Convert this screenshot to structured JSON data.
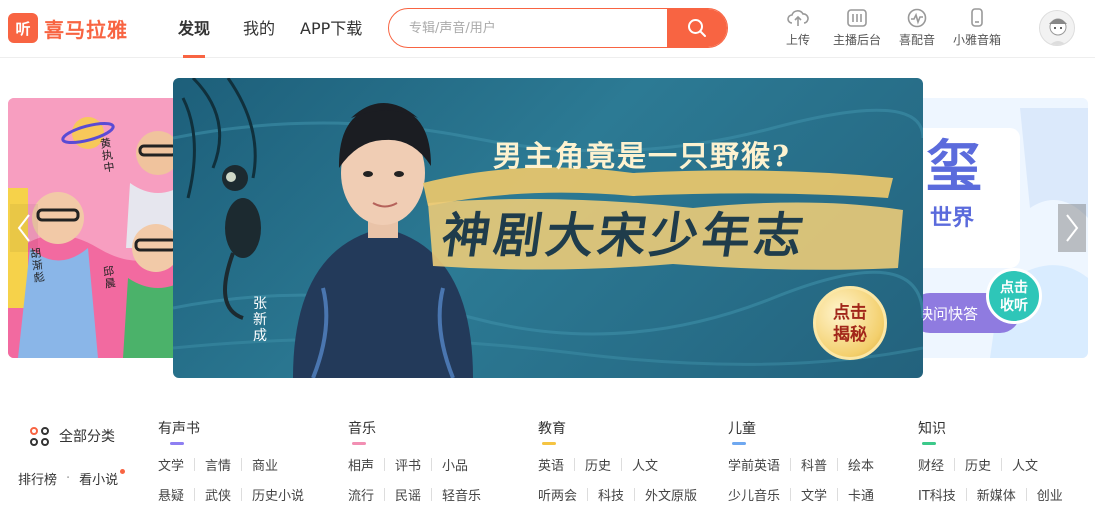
{
  "header": {
    "logo_mark": "听",
    "logo_text": "喜马拉雅",
    "nav": [
      {
        "label": "发现",
        "active": true
      },
      {
        "label": "我的",
        "active": false
      },
      {
        "label": "APP下载",
        "active": false
      }
    ],
    "search_placeholder": "专辑/声音/用户",
    "tools": [
      {
        "label": "上传",
        "icon": "upload-cloud-icon"
      },
      {
        "label": "主播后台",
        "icon": "mixer-icon"
      },
      {
        "label": "喜配音",
        "icon": "waveform-icon"
      },
      {
        "label": "小雅音箱",
        "icon": "speaker-icon"
      }
    ]
  },
  "carousel": {
    "headline": "男主角竟是一只野猴?",
    "title": "神剧大宋少年志",
    "cta": [
      "点击",
      "揭秘"
    ],
    "actor_name": "张新成",
    "left_banner_names": [
      "黄执中",
      "胡渐彪",
      "邱晨"
    ],
    "right_banner_text": {
      "big": "玺",
      "small": "世界",
      "bottom": "快问快答",
      "cta": [
        "点击",
        "收听"
      ]
    }
  },
  "categories": {
    "all_label": "全部分类",
    "ranking": "排行榜",
    "separator": "·",
    "novel": "看小说",
    "columns": [
      {
        "title": "有声书",
        "accent": "#8e7ff2",
        "rows": [
          [
            "文学",
            "言情",
            "商业"
          ],
          [
            "悬疑",
            "武侠",
            "历史小说"
          ]
        ]
      },
      {
        "title": "音乐",
        "accent": "#f28fb3",
        "rows": [
          [
            "相声",
            "评书",
            "小品"
          ],
          [
            "流行",
            "民谣",
            "轻音乐"
          ]
        ]
      },
      {
        "title": "教育",
        "accent": "#f5c442",
        "rows": [
          [
            "英语",
            "历史",
            "人文"
          ],
          [
            "听两会",
            "科技",
            "外文原版"
          ]
        ]
      },
      {
        "title": "儿童",
        "accent": "#6fa8f0",
        "rows": [
          [
            "学前英语",
            "科普",
            "绘本"
          ],
          [
            "少儿音乐",
            "文学",
            "卡通"
          ]
        ]
      },
      {
        "title": "知识",
        "accent": "#3cc98a",
        "rows": [
          [
            "财经",
            "历史",
            "人文"
          ],
          [
            "IT科技",
            "新媒体",
            "创业"
          ]
        ]
      }
    ]
  },
  "colors": {
    "brand": "#f86442"
  }
}
